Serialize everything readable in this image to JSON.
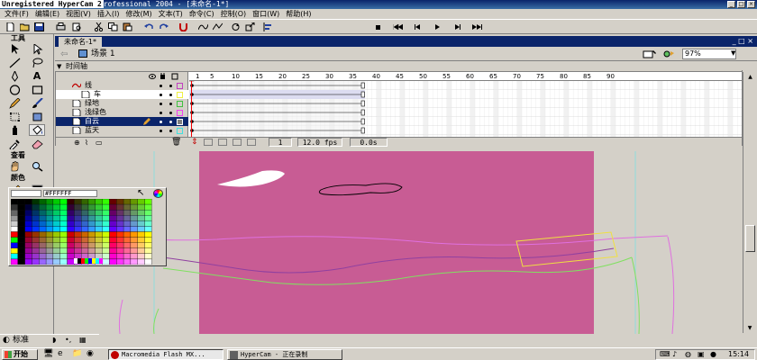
{
  "window": {
    "title_prefix": "Unregistered HyperCam 2",
    "title_rest": "rofessional 2004 - [未命名-1*]"
  },
  "menu": [
    "文件(F)",
    "编辑(E)",
    "视图(V)",
    "插入(I)",
    "修改(M)",
    "文本(T)",
    "命令(C)",
    "控制(O)",
    "窗口(W)",
    "帮助(H)"
  ],
  "tools": {
    "title": "工具",
    "view_title": "查看",
    "colors_title": "颜色"
  },
  "document": {
    "tab_label": "未命名-1*",
    "scene_label": "场景 1",
    "zoom": "97%",
    "timeline_label": "时间轴"
  },
  "layers": [
    {
      "name": "线"
    },
    {
      "name": "车"
    },
    {
      "name": "绿地"
    },
    {
      "name": "浅绿色"
    },
    {
      "name": "白云"
    },
    {
      "name": "蓝天"
    }
  ],
  "frame_numbers": [
    "1",
    "5",
    "10",
    "15",
    "20",
    "25",
    "30",
    "35",
    "40",
    "45",
    "50",
    "55",
    "60",
    "65",
    "70",
    "75",
    "80",
    "85",
    "90"
  ],
  "timeline_status": {
    "current_frame": "1",
    "fps": "12.0 fps",
    "time": "0.0s"
  },
  "color_popup": {
    "hex": "#FFFFFF"
  },
  "bottom_panel": {
    "label": "标准"
  },
  "taskbar": {
    "start_label": "开始",
    "tasks": [
      "Macromedia Flash MX...",
      "HyperCam - 正在录制"
    ],
    "clock": "15:14"
  },
  "colors": {
    "stage": "#c85c94",
    "titlebar": "#0a246a",
    "chrome": "#d4d0c8"
  }
}
